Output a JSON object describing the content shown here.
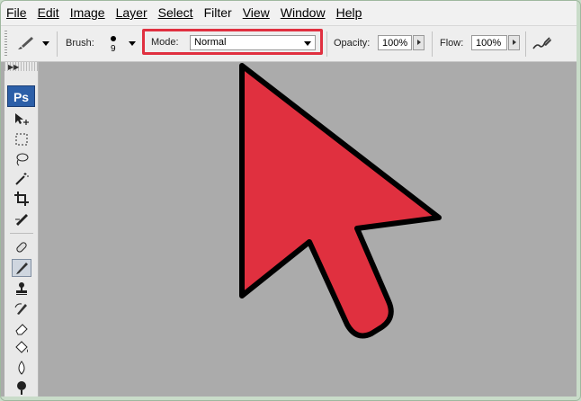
{
  "menu": [
    "File",
    "Edit",
    "Image",
    "Layer",
    "Select",
    "Filter",
    "View",
    "Window",
    "Help"
  ],
  "options": {
    "brush_label": "Brush:",
    "brush_size": "9",
    "mode_label": "Mode:",
    "mode_value": "Normal",
    "opacity_label": "Opacity:",
    "opacity_value": "100%",
    "flow_label": "Flow:",
    "flow_value": "100%"
  },
  "toolbox": {
    "logo": "Ps",
    "tools": [
      "move-icon",
      "marquee-icon",
      "lasso-icon",
      "magic-wand-icon",
      "crop-icon",
      "slice-icon",
      "healing-brush-icon",
      "brush-icon",
      "clone-stamp-icon",
      "history-brush-icon",
      "eraser-icon",
      "paint-bucket-icon",
      "blur-icon",
      "dodge-icon"
    ]
  },
  "colors": {
    "highlight": "#e03040",
    "arrow_fill": "#e0303f",
    "canvas": "#ababab"
  }
}
